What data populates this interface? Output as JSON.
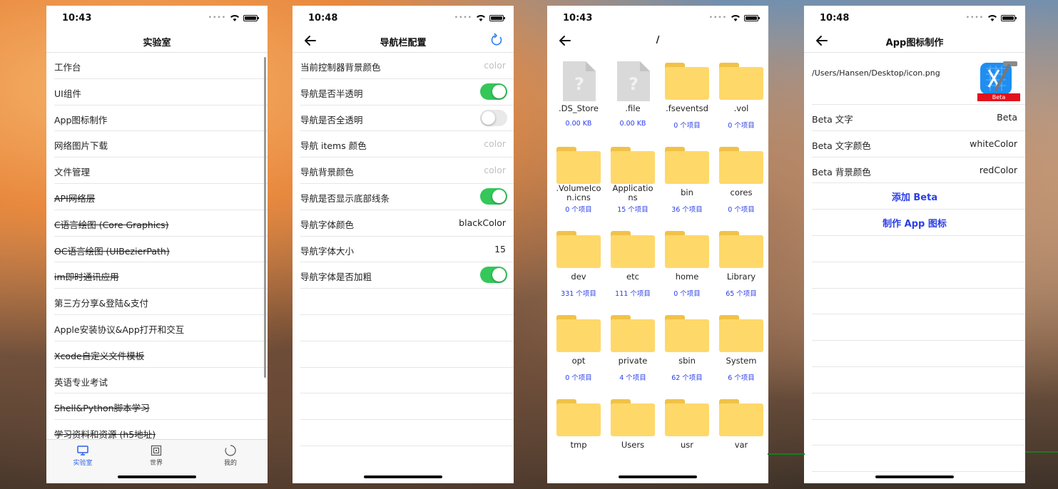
{
  "phone1": {
    "time": "10:43",
    "title": "实验室",
    "items": [
      {
        "label": "工作台",
        "strike": false
      },
      {
        "label": "UI组件",
        "strike": false
      },
      {
        "label": "App图标制作",
        "strike": false
      },
      {
        "label": "网络图片下载",
        "strike": false
      },
      {
        "label": "文件管理",
        "strike": false
      },
      {
        "label": "API网络层",
        "strike": true
      },
      {
        "label": "C语言绘图 (Core Graphics)",
        "strike": true
      },
      {
        "label": "OC语言绘图 (UIBezierPath)",
        "strike": true
      },
      {
        "label": "im即时通讯应用",
        "strike": true
      },
      {
        "label": "第三方分享&登陆&支付",
        "strike": false
      },
      {
        "label": "Apple安装协议&App打开和交互",
        "strike": false
      },
      {
        "label": "Xcode自定义文件模板",
        "strike": true
      },
      {
        "label": "英语专业考试",
        "strike": false
      },
      {
        "label": "Shell&Python脚本学习",
        "strike": true
      },
      {
        "label": "学习资料和资源 (h5地址)",
        "strike": true
      }
    ],
    "tabs": [
      {
        "label": "实验室",
        "icon": "monitor-icon",
        "active": true
      },
      {
        "label": "世界",
        "icon": "world-icon",
        "active": false
      },
      {
        "label": "我的",
        "icon": "profile-circle-icon",
        "active": false
      }
    ]
  },
  "phone2": {
    "time": "10:48",
    "title": "导航栏配置",
    "rows": [
      {
        "label": "当前控制器背景颜色",
        "type": "text",
        "value": "color",
        "muted": true
      },
      {
        "label": "导航是否半透明",
        "type": "toggle",
        "on": true
      },
      {
        "label": "导航是否全透明",
        "type": "toggle",
        "on": false
      },
      {
        "label": "导航 items 颜色",
        "type": "text",
        "value": "color",
        "muted": true
      },
      {
        "label": "导航背景颜色",
        "type": "text",
        "value": "color",
        "muted": true
      },
      {
        "label": "导航是否显示底部线条",
        "type": "toggle",
        "on": true
      },
      {
        "label": "导航字体颜色",
        "type": "text",
        "value": "blackColor",
        "muted": false
      },
      {
        "label": "导航字体大小",
        "type": "text",
        "value": "15",
        "muted": false
      },
      {
        "label": "导航字体是否加粗",
        "type": "toggle",
        "on": true
      }
    ],
    "empty_rows": 6
  },
  "phone3": {
    "time": "10:43",
    "title": "/",
    "items": [
      {
        "kind": "file",
        "name": ".DS_Store",
        "count": "0.00 KB"
      },
      {
        "kind": "file",
        "name": ".file",
        "count": "0.00 KB"
      },
      {
        "kind": "folder",
        "name": ".fseventsd",
        "count": "0 个项目"
      },
      {
        "kind": "folder",
        "name": ".vol",
        "count": "0 个项目"
      },
      {
        "kind": "folder",
        "name": ".VolumeIco n.icns",
        "count": "0 个项目"
      },
      {
        "kind": "folder",
        "name": "Applicatio ns",
        "count": "15 个项目"
      },
      {
        "kind": "folder",
        "name": "bin",
        "count": "36 个项目"
      },
      {
        "kind": "folder",
        "name": "cores",
        "count": "0 个项目"
      },
      {
        "kind": "folder",
        "name": "dev",
        "count": "331 个项目"
      },
      {
        "kind": "folder",
        "name": "etc",
        "count": "111 个项目"
      },
      {
        "kind": "folder",
        "name": "home",
        "count": "0 个项目"
      },
      {
        "kind": "folder",
        "name": "Library",
        "count": "65 个项目"
      },
      {
        "kind": "folder",
        "name": "opt",
        "count": "0 个项目"
      },
      {
        "kind": "folder",
        "name": "private",
        "count": "4 个项目"
      },
      {
        "kind": "folder",
        "name": "sbin",
        "count": "62 个项目"
      },
      {
        "kind": "folder",
        "name": "System",
        "count": "6 个项目"
      },
      {
        "kind": "folder",
        "name": "tmp",
        "count": ""
      },
      {
        "kind": "folder",
        "name": "Users",
        "count": ""
      },
      {
        "kind": "folder",
        "name": "usr",
        "count": ""
      },
      {
        "kind": "folder",
        "name": "var",
        "count": ""
      }
    ],
    "colors": {
      "folder": "#ffd86a",
      "count": "#2a3ee8"
    }
  },
  "phone4": {
    "time": "10:48",
    "title": "App图标制作",
    "path": "/Users/Hansen/Desktop/icon.png",
    "badge": "Beta",
    "rows": [
      {
        "label": "Beta 文字",
        "value": "Beta"
      },
      {
        "label": "Beta 文字颜色",
        "value": "whiteColor"
      },
      {
        "label": "Beta 背景颜色",
        "value": "redColor"
      }
    ],
    "actions": [
      "添加 Beta",
      "制作 App 图标"
    ],
    "empty_rows": 9
  }
}
